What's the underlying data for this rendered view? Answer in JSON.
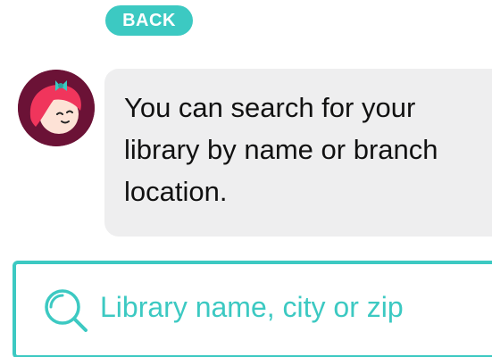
{
  "header": {
    "back_label": "BACK"
  },
  "assistant": {
    "avatar_icon": "libby-avatar-icon",
    "message": "You can search for your library by name or branch location."
  },
  "search": {
    "icon": "search-icon",
    "placeholder": "Library name, city or zip",
    "value": ""
  },
  "colors": {
    "accent": "#3cc9c2",
    "bubble": "#eeeeef",
    "avatar_bg": "#6b1236"
  }
}
